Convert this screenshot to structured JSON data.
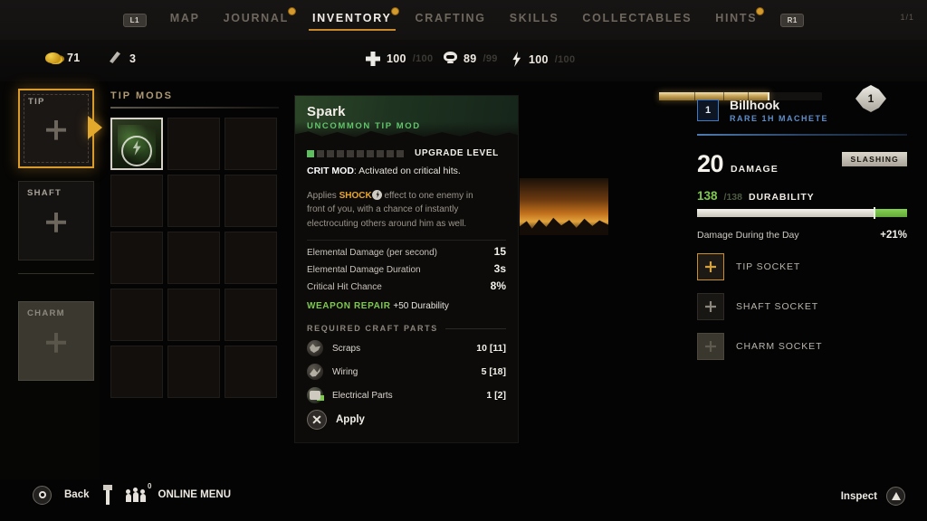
{
  "topnav": {
    "left_bumper": "L1",
    "right_bumper": "R1",
    "page_count": "1/1",
    "tabs": [
      {
        "label": "MAP",
        "active": false,
        "badge": false
      },
      {
        "label": "JOURNAL",
        "active": false,
        "badge": true
      },
      {
        "label": "INVENTORY",
        "active": true,
        "badge": true
      },
      {
        "label": "CRAFTING",
        "active": false,
        "badge": false
      },
      {
        "label": "SKILLS",
        "active": false,
        "badge": false
      },
      {
        "label": "COLLECTABLES",
        "active": false,
        "badge": false
      },
      {
        "label": "HINTS",
        "active": false,
        "badge": true
      }
    ]
  },
  "statbar": {
    "money": {
      "icon": "coins-icon",
      "value": "71"
    },
    "lockpicks": {
      "icon": "lockpick-icon",
      "value": "3"
    },
    "health": {
      "icon": "health-cross-icon",
      "value": "100",
      "max": "/100"
    },
    "immunity": {
      "icon": "skull-icon",
      "value": "89",
      "max": "/99"
    },
    "stamina": {
      "icon": "stamina-bolt-icon",
      "value": "100",
      "max": "/100"
    },
    "level": "1"
  },
  "slots": {
    "tip": {
      "label": "TIP",
      "selected": true
    },
    "shaft": {
      "label": "SHAFT",
      "selected": false
    },
    "charm": {
      "label": "CHARM",
      "selected": false
    }
  },
  "mods": {
    "title": "TIP MODS",
    "cells": [
      {
        "filled": true
      },
      {
        "filled": false
      },
      {
        "filled": false
      },
      {
        "filled": false
      },
      {
        "filled": false
      },
      {
        "filled": false
      },
      {
        "filled": false
      },
      {
        "filled": false
      },
      {
        "filled": false
      },
      {
        "filled": false
      },
      {
        "filled": false
      },
      {
        "filled": false
      },
      {
        "filled": false
      },
      {
        "filled": false
      },
      {
        "filled": false
      }
    ]
  },
  "detail": {
    "name": "Spark",
    "rarity": "UNCOMMON TIP MOD",
    "upgrade_label": "UPGRADE LEVEL",
    "upgrade_filled": 1,
    "upgrade_total": 10,
    "crit_key": "CRIT MOD",
    "crit_text": ": Activated on critical hits.",
    "desc_pre": "Applies ",
    "desc_keyword": "SHOCK",
    "desc_post": " effect to one enemy in front of you, with a chance of instantly electrocuting others around him as well.",
    "stats": [
      {
        "label": "Elemental Damage (per second)",
        "value": "15"
      },
      {
        "label": "Elemental Damage Duration",
        "value": "3s"
      },
      {
        "label": "Critical Hit Chance",
        "value": "8%"
      }
    ],
    "repair_key": "WEAPON REPAIR",
    "repair_value": " +50 Durability",
    "craft_title": "REQUIRED CRAFT PARTS",
    "parts": [
      {
        "icon": "scraps-icon",
        "name": "Scraps",
        "qty": "10 [11]"
      },
      {
        "icon": "wiring-icon",
        "name": "Wiring",
        "qty": "5 [18]"
      },
      {
        "icon": "electrical-parts-icon",
        "name": "Electrical Parts",
        "qty": "1 [2]"
      }
    ],
    "apply_label": "Apply"
  },
  "weapon": {
    "level": "1",
    "name": "Billhook",
    "type": "RARE 1H MACHETE",
    "damage_value": "20",
    "damage_label": "DAMAGE",
    "damage_tag": "SLASHING",
    "durability_current": "138",
    "durability_max": "/138",
    "durability_label": "DURABILITY",
    "bonus_label": "Damage During the Day",
    "bonus_value": "+21%",
    "sockets": [
      {
        "label": "TIP SOCKET",
        "state": "active"
      },
      {
        "label": "SHAFT SOCKET",
        "state": "empty"
      },
      {
        "label": "CHARM SOCKET",
        "state": "charm"
      }
    ]
  },
  "bottom": {
    "back_label": "Back",
    "online_label": "ONLINE MENU",
    "online_badge": "0",
    "inspect_label": "Inspect"
  }
}
